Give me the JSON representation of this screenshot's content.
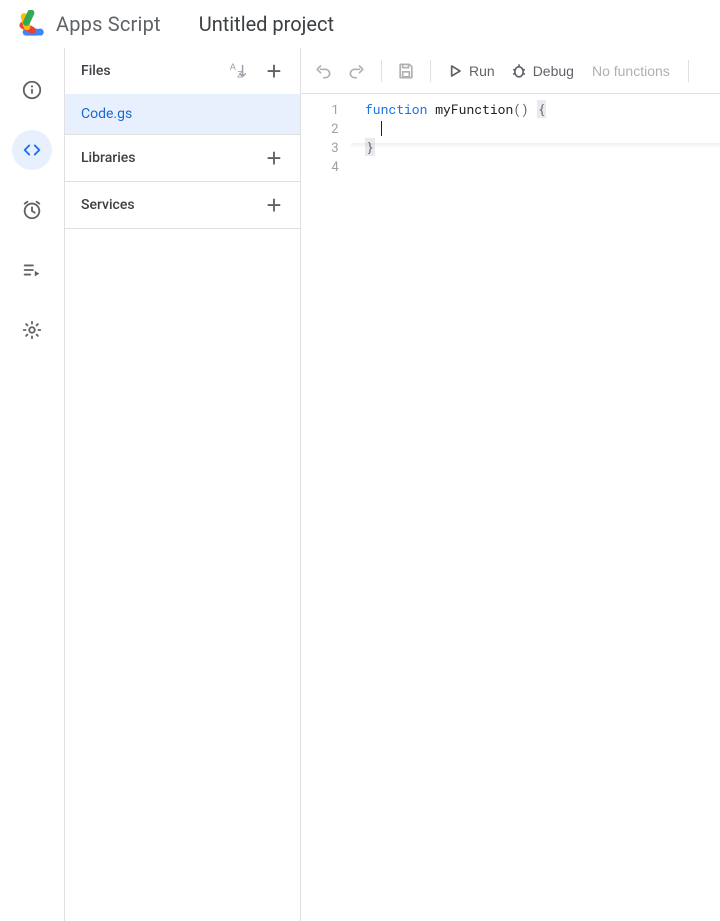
{
  "header": {
    "brand": "Apps Script",
    "project_title": "Untitled project"
  },
  "sidebar": {
    "files_label": "Files",
    "libraries_label": "Libraries",
    "services_label": "Services",
    "files": [
      {
        "name": "Code.gs",
        "selected": true
      }
    ]
  },
  "toolbar": {
    "run_label": "Run",
    "debug_label": "Debug",
    "functions_label": "No functions"
  },
  "editor": {
    "line_numbers": [
      "1",
      "2",
      "3",
      "4"
    ],
    "tokens": {
      "line1_kw": "function",
      "line1_sp": " ",
      "line1_fn": "myFunction",
      "line1_par": "()",
      "line1_sp2": " ",
      "line1_brace": "{",
      "line2_indent": "  ",
      "line3_brace": "}"
    }
  }
}
